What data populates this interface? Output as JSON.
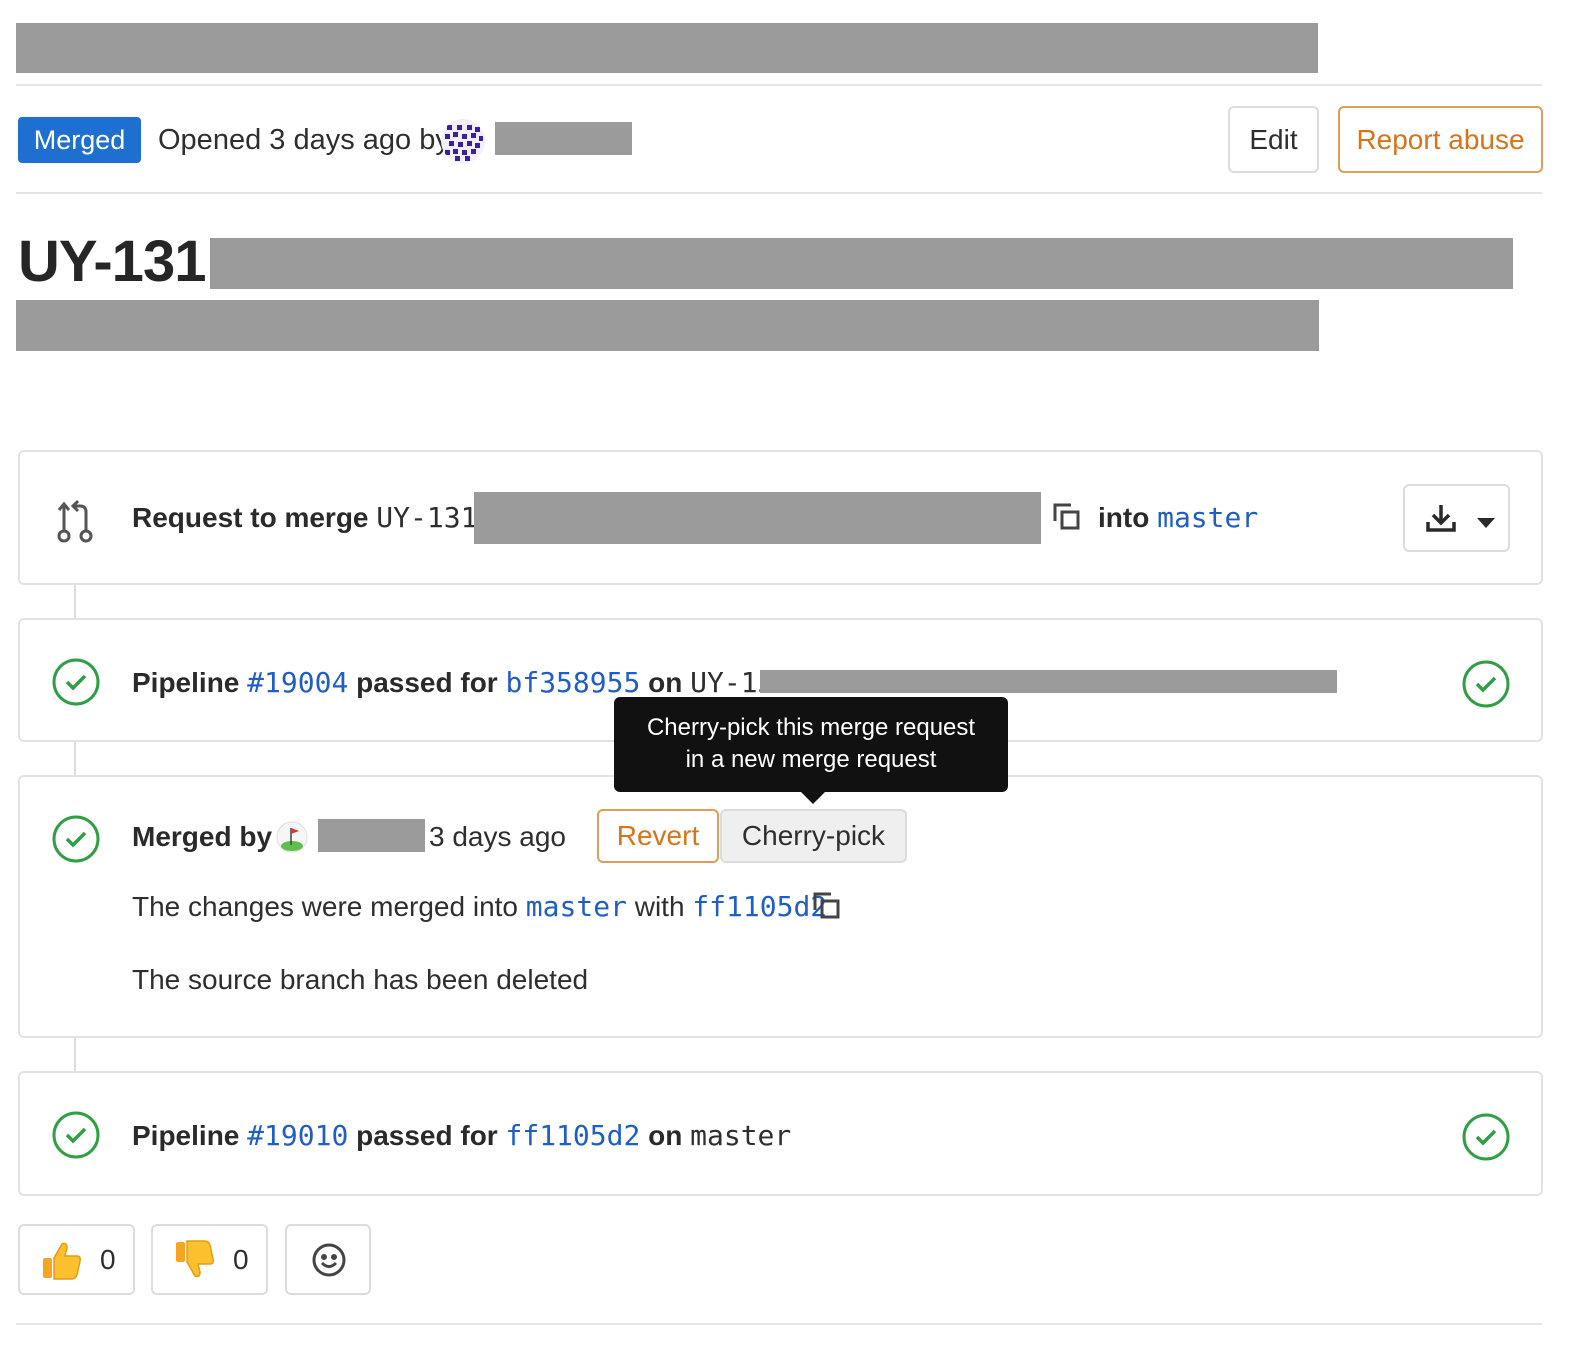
{
  "header": {
    "status_badge": "Merged",
    "opened_text": "Opened 3 days ago by",
    "edit_label": "Edit",
    "report_label": "Report abuse"
  },
  "title": {
    "prefix": "UY-131"
  },
  "merge_request": {
    "request_label": "Request to merge",
    "source_branch_prefix": "UY-131–",
    "into_label": "into",
    "target_branch": "master"
  },
  "pipeline_1": {
    "label": "Pipeline",
    "id": "#19004",
    "passed_for": "passed for",
    "commit": "bf358955",
    "on_label": "on",
    "branch_prefix": "UY-131–"
  },
  "tooltip": {
    "line1": "Cherry-pick this merge request",
    "line2": "in a new merge request"
  },
  "merged": {
    "merged_by": "Merged by",
    "time_ago": "3 days ago",
    "revert_label": "Revert",
    "cherry_pick_label": "Cherry-pick",
    "changes_text": "The changes were merged into",
    "target_branch": "master",
    "with_label": "with",
    "merge_commit": "ff1105d2",
    "source_deleted": "The source branch has been deleted"
  },
  "pipeline_2": {
    "label": "Pipeline",
    "id": "#19010",
    "passed_for": "passed for",
    "commit": "ff1105d2",
    "on_label": "on",
    "branch": "master"
  },
  "awards": {
    "thumbs_up_count": "0",
    "thumbs_down_count": "0"
  },
  "colors": {
    "merged_badge": "#1f6fd0",
    "link": "#1f5ec6",
    "success": "#2f9e44",
    "warning_outline": "#d5741a"
  }
}
